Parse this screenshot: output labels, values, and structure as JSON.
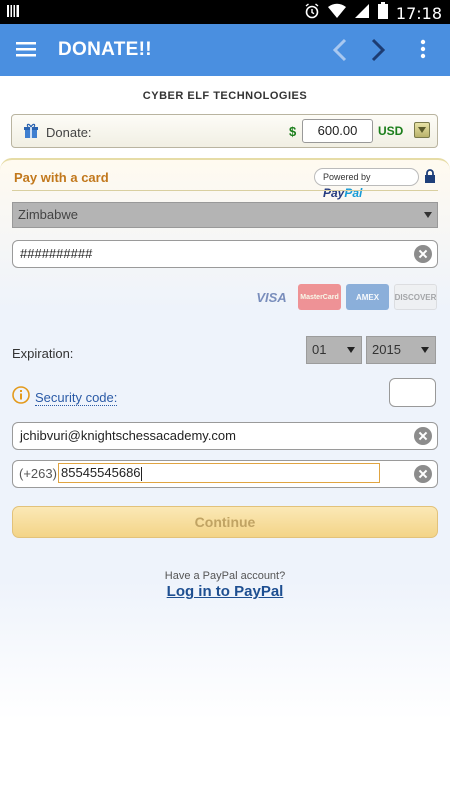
{
  "status_bar": {
    "time": "17:18"
  },
  "app_bar": {
    "title": "DONATE!!"
  },
  "merchant": {
    "name": "CYBER ELF TECHNOLOGIES"
  },
  "donation": {
    "label": "Donate:",
    "currency_symbol": "$",
    "amount": "600.00",
    "currency_code": "USD"
  },
  "payment": {
    "heading": "Pay with a card",
    "powered_by": "Powered by",
    "paypal_part1": "Pay",
    "paypal_part2": "Pal",
    "country": "Zimbabwe",
    "card_number": "##########",
    "card_logos": [
      "VISA",
      "MasterCard",
      "AMEX",
      "DISCOVER"
    ],
    "expiration_label": "Expiration:",
    "exp_month": "01",
    "exp_year": "2015",
    "security_label": "Security code:",
    "email": "jchibvuri@knightschessacademy.com",
    "phone_prefix": "(+263)",
    "phone_number": "85545545686",
    "continue_label": "Continue"
  },
  "paypal_login": {
    "prompt": "Have a PayPal account?",
    "link": "Log in to PayPal"
  },
  "colors": {
    "app_bar": "#4a8fe0",
    "accent_orange": "#c2781c",
    "link_blue": "#1e4f91",
    "money_green": "#1b7e1b"
  }
}
